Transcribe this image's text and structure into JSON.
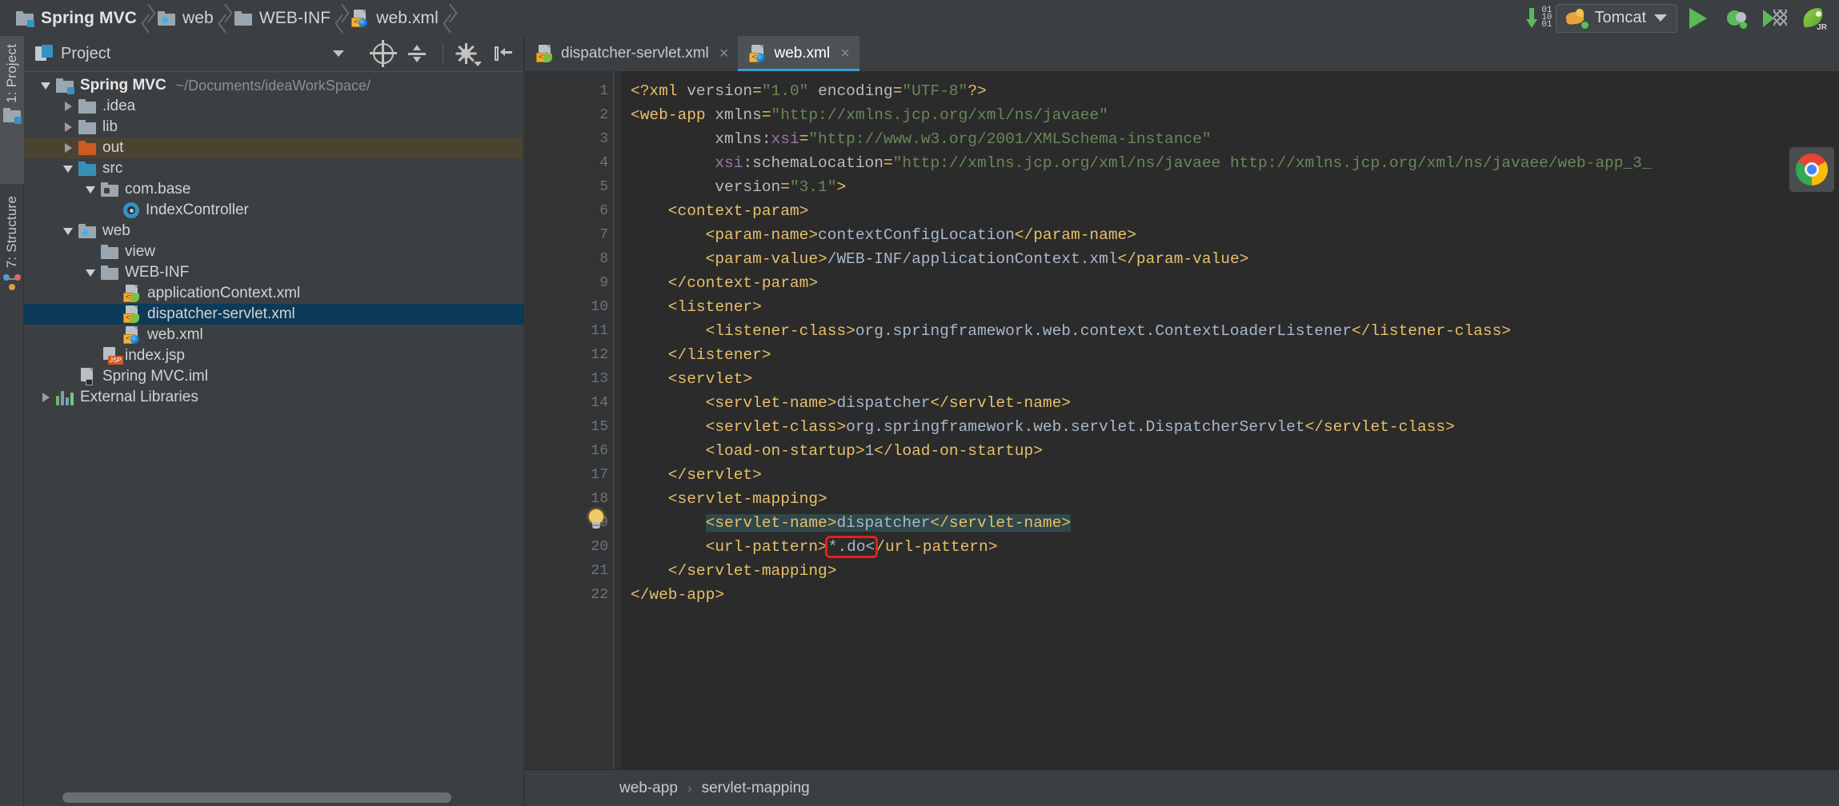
{
  "navbar": {
    "breadcrumbs": [
      {
        "label": "Spring MVC",
        "icon": "module-folder-icon"
      },
      {
        "label": "web",
        "icon": "web-folder-icon"
      },
      {
        "label": "WEB-INF",
        "icon": "folder-icon"
      },
      {
        "label": "web.xml",
        "icon": "web-xml-file-icon"
      }
    ]
  },
  "toolbar": {
    "update_icon": "update-application-icon",
    "bits": [
      "01",
      "10",
      "01"
    ],
    "run_config": {
      "label": "Tomcat",
      "icon": "tomcat-icon"
    },
    "run_button": "run-button",
    "debug_button": "debug-button",
    "coverage_button": "run-with-coverage-button",
    "jrebel_button": "jrebel-run-button",
    "jrebel_label": "JR"
  },
  "left_strip": {
    "tabs": [
      {
        "label": "1: Project",
        "active": true
      },
      {
        "label": "7: Structure",
        "active": false
      }
    ]
  },
  "project_panel": {
    "title": "Project",
    "header_icons": [
      "project-view-icon",
      "chevron-down-icon",
      "scroll-from-source-icon",
      "collapse-all-icon",
      "settings-gear-icon",
      "hide-panel-icon"
    ],
    "tree": [
      {
        "id": "spring-mvc",
        "label": "Spring MVC",
        "sub": "~/Documents/ideaWorkSpace/",
        "indent": 0,
        "twisty": "down",
        "icon": "module-folder",
        "bold": true,
        "state": ""
      },
      {
        "id": "idea",
        "label": ".idea",
        "sub": "",
        "indent": 1,
        "twisty": "right",
        "icon": "folder",
        "bold": false,
        "state": ""
      },
      {
        "id": "lib",
        "label": "lib",
        "sub": "",
        "indent": 1,
        "twisty": "right",
        "icon": "folder",
        "bold": false,
        "state": ""
      },
      {
        "id": "out",
        "label": "out",
        "sub": "",
        "indent": 1,
        "twisty": "right",
        "icon": "folder-excluded",
        "bold": false,
        "state": "hover"
      },
      {
        "id": "src",
        "label": "src",
        "sub": "",
        "indent": 1,
        "twisty": "down",
        "icon": "folder-source",
        "bold": false,
        "state": ""
      },
      {
        "id": "com-base",
        "label": "com.base",
        "sub": "",
        "indent": 2,
        "twisty": "down",
        "icon": "package",
        "bold": false,
        "state": ""
      },
      {
        "id": "index-controller",
        "label": "IndexController",
        "sub": "",
        "indent": 3,
        "twisty": "none",
        "icon": "java-class",
        "bold": false,
        "state": ""
      },
      {
        "id": "web",
        "label": "web",
        "sub": "",
        "indent": 1,
        "twisty": "down",
        "icon": "folder-web",
        "bold": false,
        "state": ""
      },
      {
        "id": "view",
        "label": "view",
        "sub": "",
        "indent": 2,
        "twisty": "none",
        "icon": "folder",
        "bold": false,
        "state": ""
      },
      {
        "id": "web-inf",
        "label": "WEB-INF",
        "sub": "",
        "indent": 2,
        "twisty": "down",
        "icon": "folder",
        "bold": false,
        "state": ""
      },
      {
        "id": "application-context-xml",
        "label": "applicationContext.xml",
        "sub": "",
        "indent": 3,
        "twisty": "none",
        "icon": "spring-xml",
        "bold": false,
        "state": ""
      },
      {
        "id": "dispatcher-servlet-xml",
        "label": "dispatcher-servlet.xml",
        "sub": "",
        "indent": 3,
        "twisty": "none",
        "icon": "spring-xml",
        "bold": false,
        "state": "selected"
      },
      {
        "id": "web-xml",
        "label": "web.xml",
        "sub": "",
        "indent": 3,
        "twisty": "none",
        "icon": "web-xml",
        "bold": false,
        "state": ""
      },
      {
        "id": "index-jsp",
        "label": "index.jsp",
        "sub": "",
        "indent": 2,
        "twisty": "none",
        "icon": "jsp",
        "bold": false,
        "state": ""
      },
      {
        "id": "spring-mvc-iml",
        "label": "Spring MVC.iml",
        "sub": "",
        "indent": 1,
        "twisty": "none",
        "icon": "iml",
        "bold": false,
        "state": ""
      },
      {
        "id": "external-libraries",
        "label": "External Libraries",
        "sub": "",
        "indent": 0,
        "twisty": "right",
        "icon": "library",
        "bold": false,
        "state": ""
      }
    ]
  },
  "editor": {
    "tabs": [
      {
        "label": "dispatcher-servlet.xml",
        "icon": "spring-xml-icon",
        "active": false,
        "close": "×"
      },
      {
        "label": "web.xml",
        "icon": "web-xml-icon",
        "active": true,
        "close": "×"
      }
    ],
    "line_numbers": [
      1,
      2,
      3,
      4,
      5,
      6,
      7,
      8,
      9,
      10,
      11,
      12,
      13,
      14,
      15,
      16,
      17,
      18,
      19,
      20,
      21,
      22
    ],
    "lines": [
      {
        "n": 1,
        "indent": 0,
        "segs": [
          {
            "t": "<?xml ",
            "c": "pi"
          },
          {
            "t": "version",
            "c": "at"
          },
          {
            "t": "=",
            "c": "tg"
          },
          {
            "t": "\"1.0\"",
            "c": "st"
          },
          {
            "t": " ",
            "c": "at"
          },
          {
            "t": "encoding",
            "c": "at"
          },
          {
            "t": "=",
            "c": "tg"
          },
          {
            "t": "\"UTF-8\"",
            "c": "st"
          },
          {
            "t": "?>",
            "c": "pi"
          }
        ]
      },
      {
        "n": 2,
        "indent": 0,
        "segs": [
          {
            "t": "<web-app ",
            "c": "tg"
          },
          {
            "t": "xmlns",
            "c": "at"
          },
          {
            "t": "=",
            "c": "tg"
          },
          {
            "t": "\"http://xmlns.jcp.org/xml/ns/javaee\"",
            "c": "st"
          }
        ]
      },
      {
        "n": 3,
        "indent": 0,
        "segs": [
          {
            "t": "         ",
            "c": "tx"
          },
          {
            "t": "xmlns:",
            "c": "at"
          },
          {
            "t": "xsi",
            "c": "ns"
          },
          {
            "t": "=",
            "c": "tg"
          },
          {
            "t": "\"http://www.w3.org/2001/XMLSchema-instance\"",
            "c": "st"
          }
        ]
      },
      {
        "n": 4,
        "indent": 0,
        "segs": [
          {
            "t": "         ",
            "c": "tx"
          },
          {
            "t": "xsi",
            "c": "ns"
          },
          {
            "t": ":schemaLocation",
            "c": "at"
          },
          {
            "t": "=",
            "c": "tg"
          },
          {
            "t": "\"http://xmlns.jcp.org/xml/ns/javaee http://xmlns.jcp.org/xml/ns/javaee/web-app_3_",
            "c": "st"
          }
        ]
      },
      {
        "n": 5,
        "indent": 0,
        "segs": [
          {
            "t": "         ",
            "c": "tx"
          },
          {
            "t": "version",
            "c": "at"
          },
          {
            "t": "=",
            "c": "tg"
          },
          {
            "t": "\"3.1\"",
            "c": "st"
          },
          {
            "t": ">",
            "c": "tg"
          }
        ]
      },
      {
        "n": 6,
        "indent": 0,
        "segs": [
          {
            "t": "    <context-param>",
            "c": "tg"
          }
        ]
      },
      {
        "n": 7,
        "indent": 0,
        "segs": [
          {
            "t": "        <param-name>",
            "c": "tg"
          },
          {
            "t": "contextConfigLocation",
            "c": "tx"
          },
          {
            "t": "</param-name>",
            "c": "tg"
          }
        ]
      },
      {
        "n": 8,
        "indent": 0,
        "segs": [
          {
            "t": "        <param-value>",
            "c": "tg"
          },
          {
            "t": "/WEB-INF/applicationContext.xml",
            "c": "tx"
          },
          {
            "t": "</param-value>",
            "c": "tg"
          }
        ]
      },
      {
        "n": 9,
        "indent": 0,
        "segs": [
          {
            "t": "    </context-param>",
            "c": "tg"
          }
        ]
      },
      {
        "n": 10,
        "indent": 0,
        "segs": [
          {
            "t": "    <listener>",
            "c": "tg"
          }
        ]
      },
      {
        "n": 11,
        "indent": 0,
        "segs": [
          {
            "t": "        <listener-class>",
            "c": "tg"
          },
          {
            "t": "org.springframework.web.context.ContextLoaderListener",
            "c": "tx"
          },
          {
            "t": "</listener-class>",
            "c": "tg"
          }
        ]
      },
      {
        "n": 12,
        "indent": 0,
        "segs": [
          {
            "t": "    </listener>",
            "c": "tg"
          }
        ]
      },
      {
        "n": 13,
        "indent": 0,
        "segs": [
          {
            "t": "    <servlet>",
            "c": "tg"
          }
        ]
      },
      {
        "n": 14,
        "indent": 0,
        "segs": [
          {
            "t": "        <servlet-name>",
            "c": "tg"
          },
          {
            "t": "dispatcher",
            "c": "tx"
          },
          {
            "t": "</servlet-name>",
            "c": "tg"
          }
        ]
      },
      {
        "n": 15,
        "indent": 0,
        "segs": [
          {
            "t": "        <servlet-class>",
            "c": "tg"
          },
          {
            "t": "org.springframework.web.servlet.DispatcherServlet",
            "c": "tx"
          },
          {
            "t": "</servlet-class>",
            "c": "tg"
          }
        ]
      },
      {
        "n": 16,
        "indent": 0,
        "segs": [
          {
            "t": "        <load-on-startup>",
            "c": "tg"
          },
          {
            "t": "1",
            "c": "tx"
          },
          {
            "t": "</load-on-startup>",
            "c": "tg"
          }
        ]
      },
      {
        "n": 17,
        "indent": 0,
        "segs": [
          {
            "t": "    </servlet>",
            "c": "tg"
          }
        ]
      },
      {
        "n": 18,
        "indent": 0,
        "segs": [
          {
            "t": "    <servlet-mapping>",
            "c": "tg"
          }
        ]
      },
      {
        "n": 19,
        "indent": 0,
        "segs": [
          {
            "t": "        ",
            "c": "tx"
          },
          {
            "t": "<servlet-name>",
            "c": "tg",
            "hl": true
          },
          {
            "t": "dispatcher",
            "c": "tx",
            "hl": true
          },
          {
            "t": "</servlet-name>",
            "c": "tg",
            "hl": true
          }
        ]
      },
      {
        "n": 20,
        "indent": 0,
        "segs": [
          {
            "t": "        <url-pattern>",
            "c": "tg"
          },
          {
            "t": "*.do<",
            "c": "tx",
            "box": true
          },
          {
            "t": "/url-pattern>",
            "c": "tg"
          }
        ]
      },
      {
        "n": 21,
        "indent": 0,
        "segs": [
          {
            "t": "    </servlet-mapping>",
            "c": "tg"
          }
        ]
      },
      {
        "n": 22,
        "indent": 0,
        "segs": [
          {
            "t": "</web-app>",
            "c": "tg"
          }
        ]
      }
    ],
    "folds": [
      {
        "line": 2,
        "type": "open"
      },
      {
        "line": 6,
        "type": "open"
      },
      {
        "line": 9,
        "type": "close"
      },
      {
        "line": 10,
        "type": "open"
      },
      {
        "line": 12,
        "type": "close"
      },
      {
        "line": 13,
        "type": "open"
      },
      {
        "line": 17,
        "type": "close"
      },
      {
        "line": 18,
        "type": "open"
      },
      {
        "line": 21,
        "type": "close"
      },
      {
        "line": 22,
        "type": "close"
      }
    ],
    "bulb_line": 19,
    "chrome_overlay_icon": "chrome-browser-icon"
  },
  "status_bar": {
    "breadcrumb": [
      "web-app",
      "servlet-mapping"
    ],
    "separator": "›"
  }
}
